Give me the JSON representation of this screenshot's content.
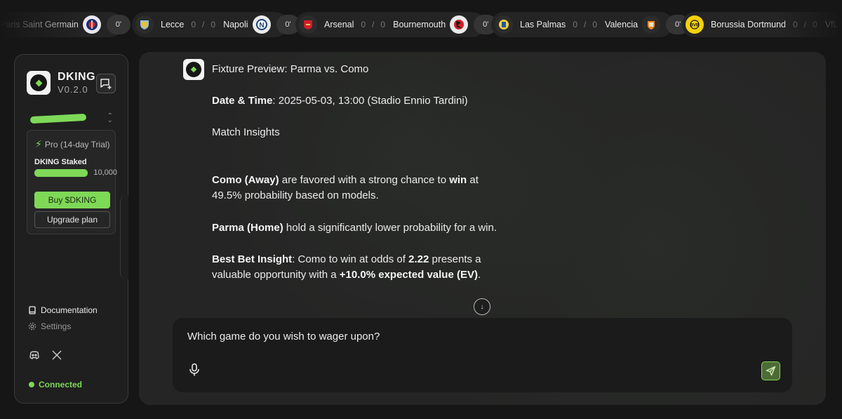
{
  "ticker": {
    "fixtures": [
      {
        "home": "Paris Saint Germain",
        "home_crest": "psg-crest-icon",
        "minute": "0'"
      },
      {
        "home": "Lecce",
        "away": "Napoli",
        "home_goals": "0",
        "away_goals": "0",
        "sep": "/",
        "home_crest": "lecce-crest-icon",
        "away_crest": "napoli-crest-icon",
        "minute": "0'"
      },
      {
        "home": "Arsenal",
        "away": "Bournemouth",
        "home_goals": "0",
        "away_goals": "0",
        "sep": "/",
        "home_crest": "arsenal-crest-icon",
        "away_crest": "bournemouth-crest-icon",
        "minute": "0'"
      },
      {
        "home": "Las Palmas",
        "away": "Valencia",
        "home_goals": "0",
        "away_goals": "0",
        "sep": "/",
        "home_crest": "las-palmas-crest-icon",
        "away_crest": "valencia-crest-icon",
        "minute": "0'"
      },
      {
        "home": "Borussia Dortmund",
        "away": "VfL Wolfsburg",
        "home_goals": "0",
        "away_goals": "0",
        "sep": "/",
        "home_crest": "dortmund-crest-icon",
        "minute": ""
      }
    ]
  },
  "sidebar": {
    "brand_name": "DKING",
    "version": "V0.2.0",
    "plan": "Pro (14-day Trial)",
    "staked_label": "DKING Staked",
    "staked_value": "10,000",
    "buy_label": "Buy $DKING",
    "upgrade_label": "Upgrade plan",
    "nav": {
      "documentation": "Documentation",
      "settings": "Settings"
    },
    "status": "Connected"
  },
  "chat": {
    "title": "Fixture Preview: Parma vs. Como",
    "datetime_label": "Date & Time",
    "datetime_value": ": 2025-05-03, 13:00 (Stadio Ennio Tardini)",
    "insights_heading": "Match Insights",
    "p1_team": "Como (Away)",
    "p1_mid": " are favored with a strong chance to ",
    "p1_win": "win",
    "p1_end": " at 49.5% probability based on models.",
    "p2_team": "Parma (Home)",
    "p2_end": " hold a significantly lower probability for a win.",
    "p3_label": "Best Bet Insight",
    "p3_mid": ": Como to win at odds of ",
    "p3_odds": "2.22",
    "p3_mid2": " presents a valuable opportunity with a ",
    "p3_ev": "+10.0% expected value (EV)",
    "p3_end": "."
  },
  "composer": {
    "text": "Which game do you wish to wager upon?"
  },
  "colors": {
    "accent": "#7ed957",
    "panel": "#252525",
    "background": "#161616"
  }
}
